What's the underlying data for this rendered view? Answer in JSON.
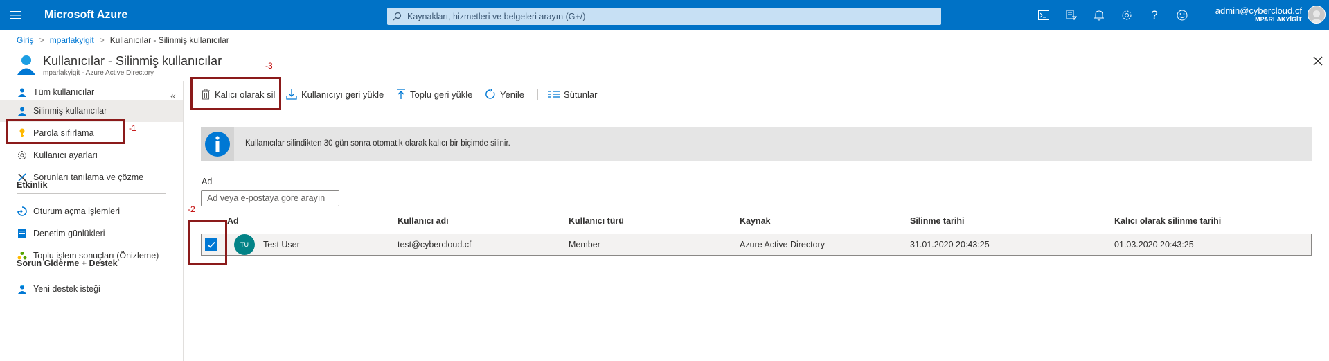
{
  "topbar": {
    "menu_icon": "hamburger-icon",
    "brand": "Microsoft Azure",
    "search_placeholder": "Kaynakları, hizmetleri ve belgeleri arayın (G+/)",
    "icons": [
      "cloud-shell-icon",
      "directory-filter-icon",
      "bell-icon",
      "gear-icon",
      "help-icon",
      "smiley-icon"
    ],
    "account_email": "admin@cybercloud.cf",
    "account_tenant": "MPARLAKYİGİT"
  },
  "breadcrumb": {
    "items": [
      "Giriş",
      "mparlakyigit"
    ],
    "current": "Kullanıcılar - Silinmiş kullanıcılar"
  },
  "page": {
    "title": "Kullanıcılar - Silinmiş kullanıcılar",
    "subtitle": "mparlakyigit - Azure Active Directory"
  },
  "sidebar": {
    "collapse_glyph": "«",
    "items": [
      {
        "label": "Tüm kullanıcılar",
        "icon": "user-icon"
      },
      {
        "label": "Silinmiş kullanıcılar",
        "icon": "user-icon",
        "selected": true
      },
      {
        "label": "Parola sıfırlama",
        "icon": "key-icon"
      },
      {
        "label": "Kullanıcı ayarları",
        "icon": "gear-icon"
      },
      {
        "label": "Sorunları tanılama ve çözme",
        "icon": "wrench-icon"
      }
    ],
    "section_activity": "Etkinlik",
    "activity_items": [
      {
        "label": "Oturum açma işlemleri",
        "icon": "sign-in-icon"
      },
      {
        "label": "Denetim günlükleri",
        "icon": "log-icon"
      },
      {
        "label": "Toplu işlem sonuçları (Önizleme)",
        "icon": "bulk-icon"
      }
    ],
    "section_support": "Sorun Giderme + Destek",
    "support_items": [
      {
        "label": "Yeni destek isteği",
        "icon": "support-user-icon"
      }
    ]
  },
  "toolbar": {
    "delete_permanently": "Kalıcı olarak sil",
    "restore_user": "Kullanıcıyı geri yükle",
    "bulk_restore": "Toplu geri yükle",
    "refresh": "Yenile",
    "columns": "Sütunlar"
  },
  "info": {
    "text": "Kullanıcılar silindikten 30 gün sonra otomatik olarak kalıcı bir biçimde silinir."
  },
  "filter": {
    "label": "Ad",
    "placeholder": "Ad veya e-postaya göre arayın"
  },
  "table": {
    "headers": [
      "Ad",
      "Kullanıcı adı",
      "Kullanıcı türü",
      "Kaynak",
      "Silinme tarihi",
      "Kalıcı olarak silinme tarihi"
    ],
    "rows": [
      {
        "initials": "TU",
        "name": "Test User",
        "username": "test@cybercloud.cf",
        "type": "Member",
        "source": "Azure Active Directory",
        "deleted": "31.01.2020 20:43:25",
        "permanent_delete": "01.03.2020 20:43:25",
        "checked": true
      }
    ]
  },
  "annotations": [
    "-1",
    "-2",
    "-3"
  ],
  "colors": {
    "topbar": "#0072c6",
    "accent": "#0078d4",
    "annotation": "#8b1a1a"
  }
}
